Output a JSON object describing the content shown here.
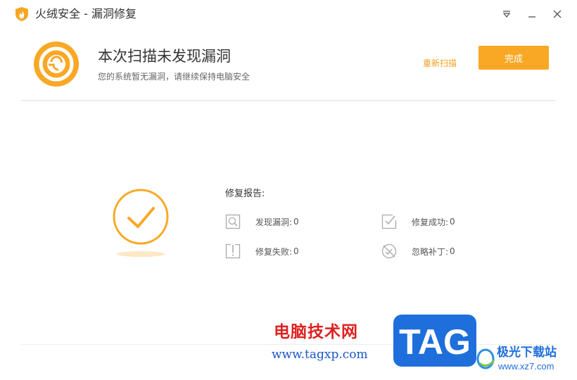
{
  "window": {
    "title": "火绒安全 - 漏洞修复",
    "icons": [
      "fire-shield-logo",
      "menu-dropdown-icon",
      "minimize-icon",
      "close-icon"
    ]
  },
  "header": {
    "headline": "本次扫描未发现漏洞",
    "subline": "您的系统暂无漏洞，请继续保持电脑安全",
    "rescan_label": "重新扫描",
    "done_label": "完成",
    "accent_color": "#f9a825"
  },
  "report": {
    "title": "修复报告:",
    "items": [
      {
        "label": "发现漏洞:",
        "value": "0",
        "icon": "search-doc-icon"
      },
      {
        "label": "修复成功:",
        "value": "0",
        "icon": "check-doc-icon"
      },
      {
        "label": "修复失败:",
        "value": "0",
        "icon": "warning-doc-icon"
      },
      {
        "label": "忽略补丁:",
        "value": "0",
        "icon": "ignore-icon"
      }
    ]
  },
  "watermark": {
    "site_name": "电脑技术网",
    "url": "www.tagxp.com",
    "badge": "TAG",
    "brand": "极光下载站",
    "brand_url": "www.xz7.com"
  }
}
